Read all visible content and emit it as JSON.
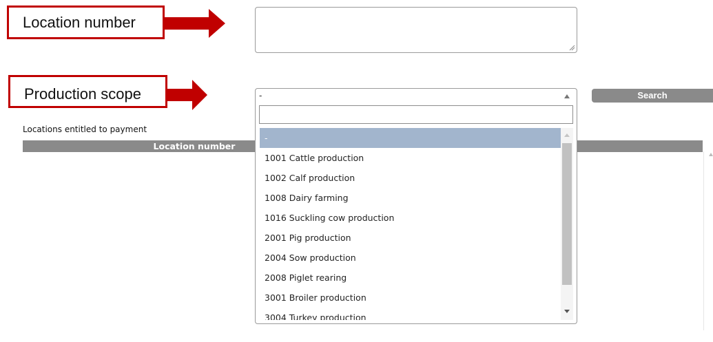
{
  "callouts": {
    "location_number": "Location number",
    "production_scope": "Production scope"
  },
  "location_field": {
    "value": ""
  },
  "production_scope_select": {
    "selected": "-"
  },
  "search_button": {
    "label": "Search"
  },
  "entitled_locations": {
    "label": "Locations entitled to payment",
    "columns": [
      "Location number"
    ]
  },
  "dropdown": {
    "filter_value": "",
    "options": [
      "-",
      "1001 Cattle production",
      "1002 Calf production",
      "1008 Dairy farming",
      "1016 Suckling cow production",
      "2001 Pig production",
      "2004 Sow production",
      "2008 Piglet rearing",
      "3001 Broiler production",
      "3004 Turkey production"
    ],
    "selected_index": 0
  },
  "colors": {
    "callout_red": "#c00000",
    "header_gray": "#8a8a8a",
    "selected_option": "#a2b5cd"
  },
  "icons": {
    "arrow": "right-arrow-icon",
    "caret": "caret-up-icon",
    "grip": "resize-grip-icon"
  }
}
